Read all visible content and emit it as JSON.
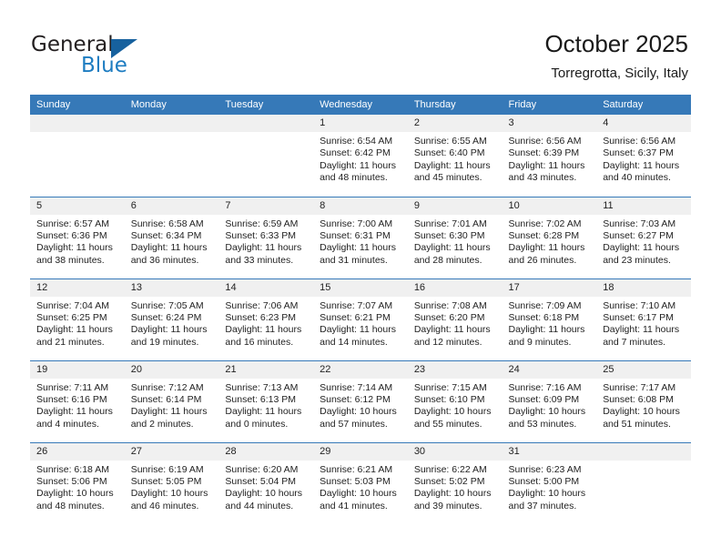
{
  "branding": {
    "logo_primary": "General",
    "logo_secondary": "Blue"
  },
  "header": {
    "title": "October 2025",
    "subtitle": "Torregrotta, Sicily, Italy"
  },
  "colors": {
    "header_blue": "#3679b8",
    "logo_blue": "#1d7cc1",
    "daynum_bg": "#f0f0f0",
    "text": "#222222"
  },
  "weekday_headers": [
    "Sunday",
    "Monday",
    "Tuesday",
    "Wednesday",
    "Thursday",
    "Friday",
    "Saturday"
  ],
  "weeks": [
    [
      {
        "empty": true
      },
      {
        "empty": true
      },
      {
        "empty": true
      },
      {
        "day": "1",
        "sunrise": "Sunrise: 6:54 AM",
        "sunset": "Sunset: 6:42 PM",
        "daylight1": "Daylight: 11 hours",
        "daylight2": "and 48 minutes."
      },
      {
        "day": "2",
        "sunrise": "Sunrise: 6:55 AM",
        "sunset": "Sunset: 6:40 PM",
        "daylight1": "Daylight: 11 hours",
        "daylight2": "and 45 minutes."
      },
      {
        "day": "3",
        "sunrise": "Sunrise: 6:56 AM",
        "sunset": "Sunset: 6:39 PM",
        "daylight1": "Daylight: 11 hours",
        "daylight2": "and 43 minutes."
      },
      {
        "day": "4",
        "sunrise": "Sunrise: 6:56 AM",
        "sunset": "Sunset: 6:37 PM",
        "daylight1": "Daylight: 11 hours",
        "daylight2": "and 40 minutes."
      }
    ],
    [
      {
        "day": "5",
        "sunrise": "Sunrise: 6:57 AM",
        "sunset": "Sunset: 6:36 PM",
        "daylight1": "Daylight: 11 hours",
        "daylight2": "and 38 minutes."
      },
      {
        "day": "6",
        "sunrise": "Sunrise: 6:58 AM",
        "sunset": "Sunset: 6:34 PM",
        "daylight1": "Daylight: 11 hours",
        "daylight2": "and 36 minutes."
      },
      {
        "day": "7",
        "sunrise": "Sunrise: 6:59 AM",
        "sunset": "Sunset: 6:33 PM",
        "daylight1": "Daylight: 11 hours",
        "daylight2": "and 33 minutes."
      },
      {
        "day": "8",
        "sunrise": "Sunrise: 7:00 AM",
        "sunset": "Sunset: 6:31 PM",
        "daylight1": "Daylight: 11 hours",
        "daylight2": "and 31 minutes."
      },
      {
        "day": "9",
        "sunrise": "Sunrise: 7:01 AM",
        "sunset": "Sunset: 6:30 PM",
        "daylight1": "Daylight: 11 hours",
        "daylight2": "and 28 minutes."
      },
      {
        "day": "10",
        "sunrise": "Sunrise: 7:02 AM",
        "sunset": "Sunset: 6:28 PM",
        "daylight1": "Daylight: 11 hours",
        "daylight2": "and 26 minutes."
      },
      {
        "day": "11",
        "sunrise": "Sunrise: 7:03 AM",
        "sunset": "Sunset: 6:27 PM",
        "daylight1": "Daylight: 11 hours",
        "daylight2": "and 23 minutes."
      }
    ],
    [
      {
        "day": "12",
        "sunrise": "Sunrise: 7:04 AM",
        "sunset": "Sunset: 6:25 PM",
        "daylight1": "Daylight: 11 hours",
        "daylight2": "and 21 minutes."
      },
      {
        "day": "13",
        "sunrise": "Sunrise: 7:05 AM",
        "sunset": "Sunset: 6:24 PM",
        "daylight1": "Daylight: 11 hours",
        "daylight2": "and 19 minutes."
      },
      {
        "day": "14",
        "sunrise": "Sunrise: 7:06 AM",
        "sunset": "Sunset: 6:23 PM",
        "daylight1": "Daylight: 11 hours",
        "daylight2": "and 16 minutes."
      },
      {
        "day": "15",
        "sunrise": "Sunrise: 7:07 AM",
        "sunset": "Sunset: 6:21 PM",
        "daylight1": "Daylight: 11 hours",
        "daylight2": "and 14 minutes."
      },
      {
        "day": "16",
        "sunrise": "Sunrise: 7:08 AM",
        "sunset": "Sunset: 6:20 PM",
        "daylight1": "Daylight: 11 hours",
        "daylight2": "and 12 minutes."
      },
      {
        "day": "17",
        "sunrise": "Sunrise: 7:09 AM",
        "sunset": "Sunset: 6:18 PM",
        "daylight1": "Daylight: 11 hours",
        "daylight2": "and 9 minutes."
      },
      {
        "day": "18",
        "sunrise": "Sunrise: 7:10 AM",
        "sunset": "Sunset: 6:17 PM",
        "daylight1": "Daylight: 11 hours",
        "daylight2": "and 7 minutes."
      }
    ],
    [
      {
        "day": "19",
        "sunrise": "Sunrise: 7:11 AM",
        "sunset": "Sunset: 6:16 PM",
        "daylight1": "Daylight: 11 hours",
        "daylight2": "and 4 minutes."
      },
      {
        "day": "20",
        "sunrise": "Sunrise: 7:12 AM",
        "sunset": "Sunset: 6:14 PM",
        "daylight1": "Daylight: 11 hours",
        "daylight2": "and 2 minutes."
      },
      {
        "day": "21",
        "sunrise": "Sunrise: 7:13 AM",
        "sunset": "Sunset: 6:13 PM",
        "daylight1": "Daylight: 11 hours",
        "daylight2": "and 0 minutes."
      },
      {
        "day": "22",
        "sunrise": "Sunrise: 7:14 AM",
        "sunset": "Sunset: 6:12 PM",
        "daylight1": "Daylight: 10 hours",
        "daylight2": "and 57 minutes."
      },
      {
        "day": "23",
        "sunrise": "Sunrise: 7:15 AM",
        "sunset": "Sunset: 6:10 PM",
        "daylight1": "Daylight: 10 hours",
        "daylight2": "and 55 minutes."
      },
      {
        "day": "24",
        "sunrise": "Sunrise: 7:16 AM",
        "sunset": "Sunset: 6:09 PM",
        "daylight1": "Daylight: 10 hours",
        "daylight2": "and 53 minutes."
      },
      {
        "day": "25",
        "sunrise": "Sunrise: 7:17 AM",
        "sunset": "Sunset: 6:08 PM",
        "daylight1": "Daylight: 10 hours",
        "daylight2": "and 51 minutes."
      }
    ],
    [
      {
        "day": "26",
        "sunrise": "Sunrise: 6:18 AM",
        "sunset": "Sunset: 5:06 PM",
        "daylight1": "Daylight: 10 hours",
        "daylight2": "and 48 minutes."
      },
      {
        "day": "27",
        "sunrise": "Sunrise: 6:19 AM",
        "sunset": "Sunset: 5:05 PM",
        "daylight1": "Daylight: 10 hours",
        "daylight2": "and 46 minutes."
      },
      {
        "day": "28",
        "sunrise": "Sunrise: 6:20 AM",
        "sunset": "Sunset: 5:04 PM",
        "daylight1": "Daylight: 10 hours",
        "daylight2": "and 44 minutes."
      },
      {
        "day": "29",
        "sunrise": "Sunrise: 6:21 AM",
        "sunset": "Sunset: 5:03 PM",
        "daylight1": "Daylight: 10 hours",
        "daylight2": "and 41 minutes."
      },
      {
        "day": "30",
        "sunrise": "Sunrise: 6:22 AM",
        "sunset": "Sunset: 5:02 PM",
        "daylight1": "Daylight: 10 hours",
        "daylight2": "and 39 minutes."
      },
      {
        "day": "31",
        "sunrise": "Sunrise: 6:23 AM",
        "sunset": "Sunset: 5:00 PM",
        "daylight1": "Daylight: 10 hours",
        "daylight2": "and 37 minutes."
      },
      {
        "empty": true
      }
    ]
  ]
}
